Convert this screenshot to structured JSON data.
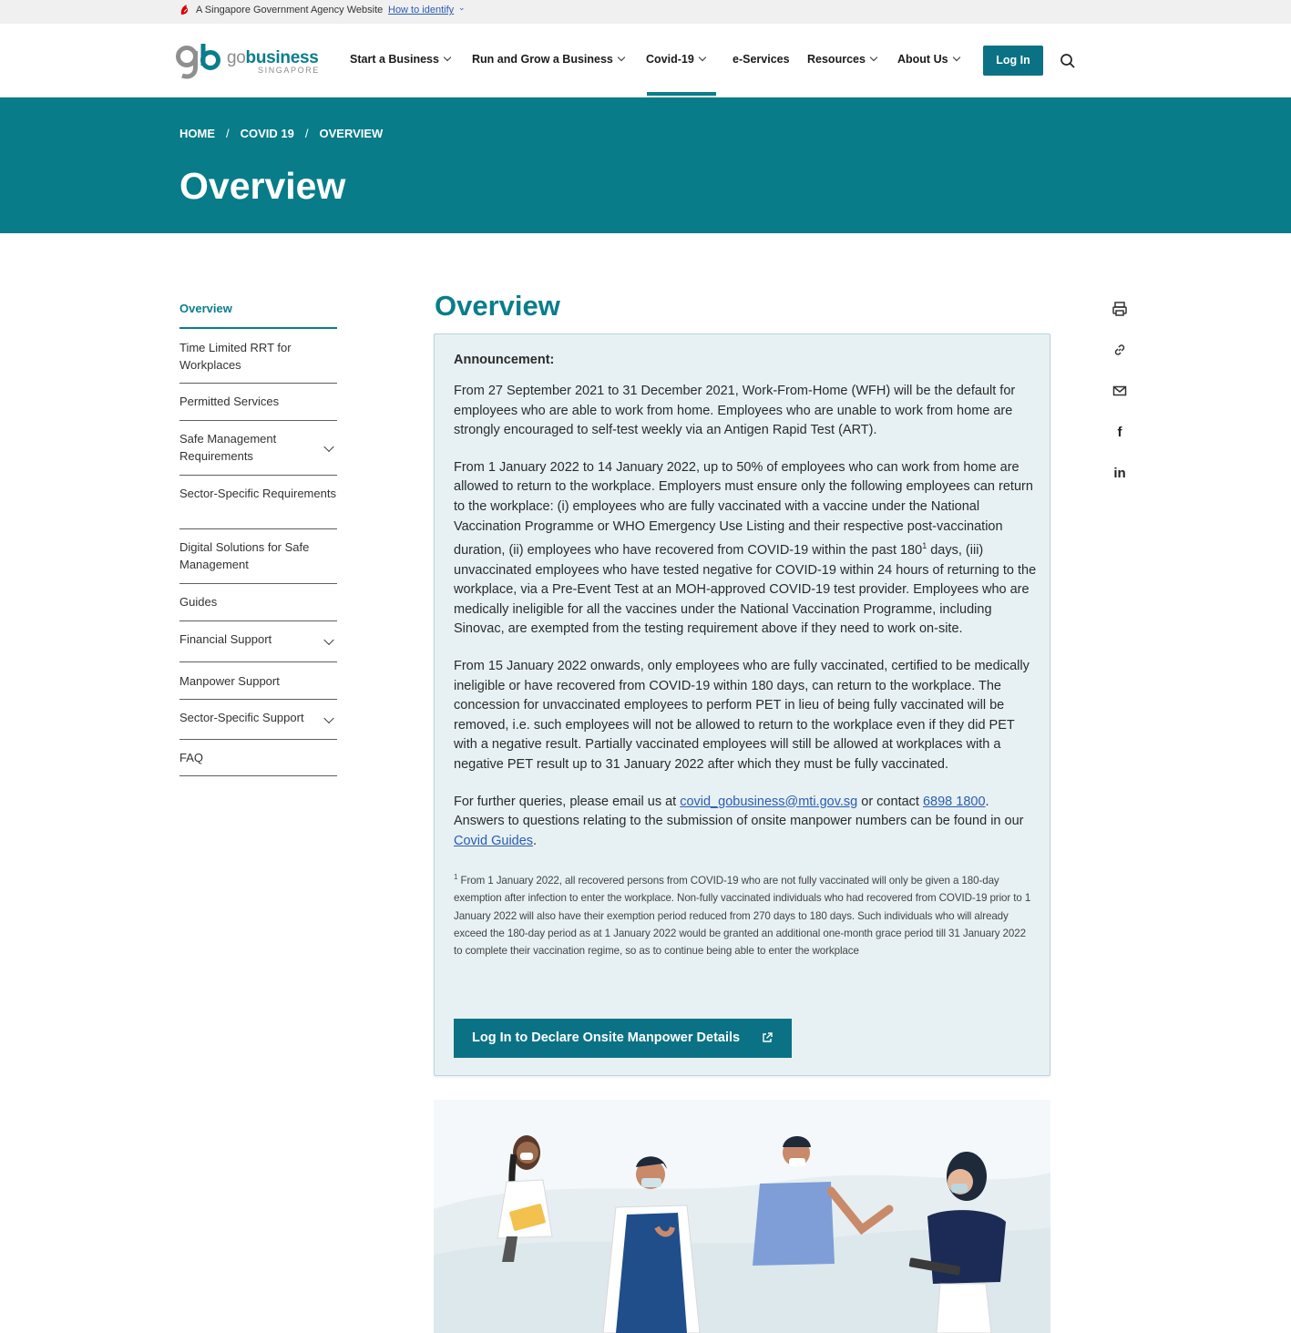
{
  "masthead": {
    "text": "A Singapore Government Agency Website",
    "link": "How to identify"
  },
  "logo": {
    "go": "go",
    "business": "business",
    "sub": "SINGAPORE"
  },
  "nav": {
    "items": [
      {
        "label": "Start a Business"
      },
      {
        "label": "Run and Grow a Business"
      },
      {
        "label": "Covid-19"
      },
      {
        "label": "e-Services"
      },
      {
        "label": "Resources"
      },
      {
        "label": "About Us"
      }
    ],
    "login": "Log In"
  },
  "breadcrumb": [
    "HOME",
    "/",
    "COVID 19",
    "/",
    "OVERVIEW"
  ],
  "hero_title": "Overview",
  "sidebar": {
    "items": [
      {
        "label": "Overview"
      },
      {
        "label": "Time Limited RRT for Workplaces"
      },
      {
        "label": "Permitted Services"
      },
      {
        "label": "Safe Management Requirements"
      },
      {
        "label": "Sector-Specific Requirements"
      },
      {
        "label": "Digital Solutions for Safe Management"
      },
      {
        "label": "Guides"
      },
      {
        "label": "Financial Support"
      },
      {
        "label": "Manpower Support"
      },
      {
        "label": "Sector-Specific Support"
      },
      {
        "label": "FAQ"
      }
    ]
  },
  "main": {
    "title": "Overview",
    "announcement_heading": "Announcement:",
    "p1": "From 27 September 2021 to 31 December 2021, Work-From-Home (WFH) will be the default for employees who are able to work from home. Employees who are unable to work from home are strongly encouraged to self-test weekly via an Antigen Rapid Test (ART).",
    "p2a": "From 1 January 2022 to 14 January 2022, up to 50% of employees who can work from home are allowed to return to the workplace. Employers must ensure only the following employees can return to the workplace: (i) employees who are fully vaccinated with a vaccine under the National Vaccination Programme or WHO Emergency Use Listing and their respective post-vaccination duration, (ii) employees who have recovered from COVID-19 within the past 180",
    "p2sup": "1",
    "p2b": " days, (iii) unvaccinated employees who have tested negative for COVID-19 within 24 hours of returning to the workplace, via a Pre-Event Test at an MOH-approved COVID-19 test provider. Employees who are medically ineligible for all the vaccines under the National Vaccination Programme, including Sinovac, are exempted from the testing requirement above if they need to work on-site.",
    "p3": "From 15 January 2022 onwards, only employees who are fully vaccinated, certified to be medically ineligible or have recovered from COVID-19 within 180 days, can return to the workplace. The concession for unvaccinated employees to perform PET in lieu of being fully vaccinated will be removed, i.e. such employees will not be allowed to return to the workplace even if they did PET with a negative result. Partially vaccinated employees will still be allowed at workplaces with a negative PET result up to 31 January 2022 after which they must be fully vaccinated.",
    "p4a": "For further queries, please email us at ",
    "p4email": "covid_gobusiness@mti.gov.sg",
    "p4b": " or contact ",
    "p4phone": "6898 1800",
    "p4c": ". Answers to questions relating to the submission of onsite manpower numbers can be found in our ",
    "p4guides": "Covid Guides",
    "p4d": ".",
    "footnote_sup": "1",
    "footnote": " From 1 January 2022, all recovered persons from COVID-19 who are not fully vaccinated will only be given a 180-day exemption after infection to enter the workplace. Non-fully vaccinated individuals who had recovered from COVID-19 prior to 1 January 2022 will also have their exemption period reduced from 270 days to 180 days. Such individuals who will already exceed the 180-day period as at 1 January 2022 would be granted an additional one-month grace period till 31 January 2022 to complete their vaccination regime, so as to continue being able to enter the workplace",
    "declare_button": "Log In to Declare Onsite Manpower Details"
  },
  "share": {
    "icons": [
      "print-icon",
      "link-icon",
      "mail-icon",
      "facebook-icon",
      "linkedin-icon"
    ],
    "facebook": "f",
    "linkedin": "in"
  },
  "colors": {
    "brand_teal": "#087c89",
    "button_teal": "#0b7285",
    "announcement_bg": "#e7f1f3",
    "link_blue": "#2a5db0"
  }
}
